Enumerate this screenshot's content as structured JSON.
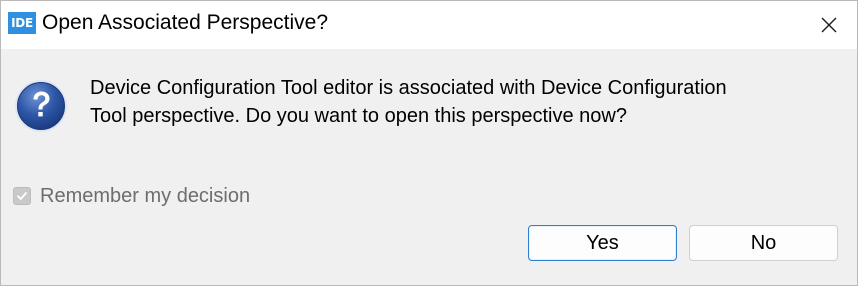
{
  "window": {
    "app_icon_text": "IDE",
    "title": "Open Associated Perspective?"
  },
  "message": {
    "line1": "Device Configuration Tool editor is associated with Device Configuration",
    "line2": "Tool perspective. Do you want to open this perspective now?"
  },
  "remember": {
    "label": "Remember my decision",
    "checked": true,
    "enabled": false
  },
  "buttons": {
    "yes_label": "Yes",
    "no_label": "No"
  },
  "colors": {
    "app_icon": "#2f8fe0",
    "question_icon": "#2b4f9c",
    "default_button_border": "#2e7fd3"
  },
  "icons": {
    "app": "ide-logo-icon",
    "close": "close-icon",
    "question": "question-icon",
    "check": "checkmark-icon"
  }
}
